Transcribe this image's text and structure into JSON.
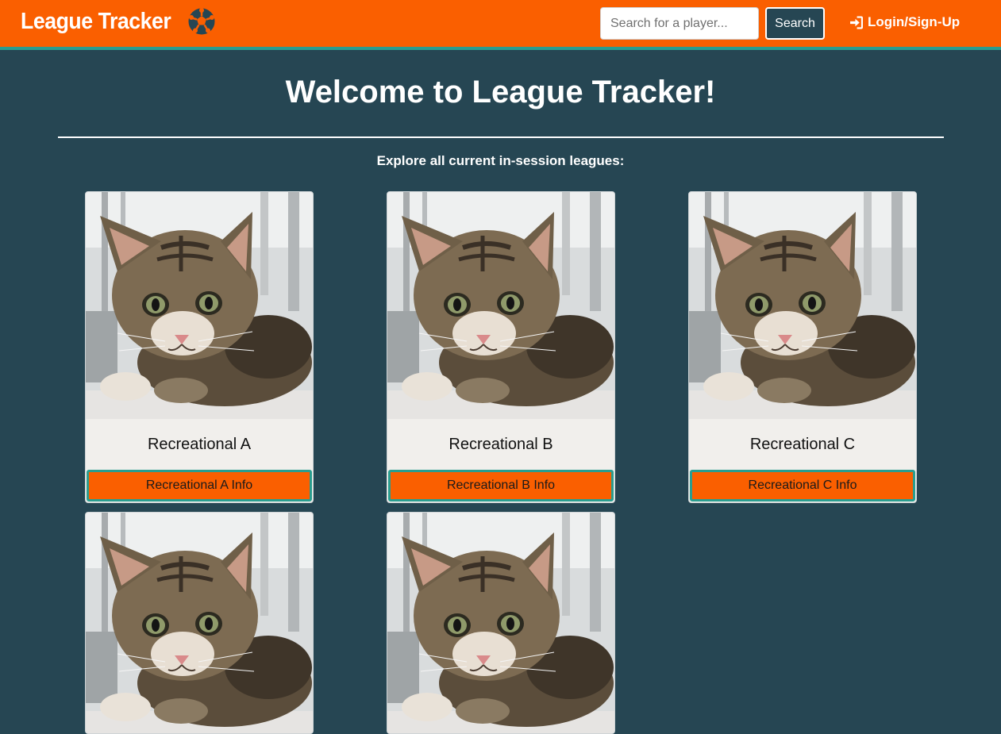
{
  "colors": {
    "accent": "#fa5f00",
    "background": "#264653",
    "stripe": "#2a9d8f",
    "card": "#f1efec"
  },
  "navbar": {
    "brand": "League Tracker",
    "brand_icon": "soccer-ball-icon",
    "search_placeholder": "Search for a player...",
    "search_button": "Search",
    "login_label": "Login/Sign-Up",
    "login_icon": "sign-in-icon"
  },
  "main": {
    "title": "Welcome to League Tracker!",
    "subtitle": "Explore all current in-session leagues:"
  },
  "leagues": [
    {
      "name": "Recreational A",
      "button": "Recreational A Info",
      "image": "kitten-photo"
    },
    {
      "name": "Recreational B",
      "button": "Recreational B Info",
      "image": "kitten-photo"
    },
    {
      "name": "Recreational C",
      "button": "Recreational C Info",
      "image": "kitten-photo"
    },
    {
      "name": "",
      "button": "",
      "image": "kitten-photo"
    },
    {
      "name": "",
      "button": "",
      "image": "kitten-photo"
    }
  ]
}
